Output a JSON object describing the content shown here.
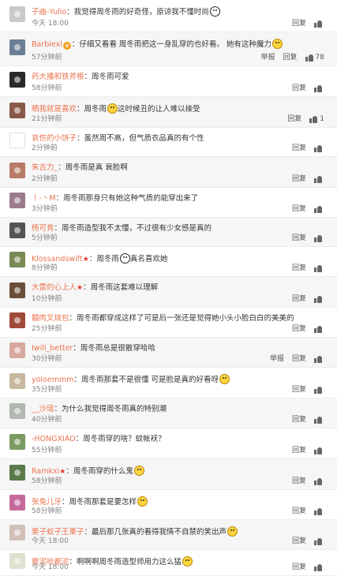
{
  "labels": {
    "reply": "回复",
    "report": "举报"
  },
  "colors": {
    "username": "#eb7350",
    "time": "#808080",
    "alt_row": "#f6f6f6"
  },
  "comments": [
    {
      "user": "子曲-Yulio",
      "badge": "",
      "text": "我觉得周冬雨的好奇怪，原谅我不懂时尚",
      "emoji": "face2",
      "time": "今天 18:00",
      "report": false,
      "likes": "",
      "avatar_color": "#c9c9c9"
    },
    {
      "user": "Barbiexl",
      "badge": "v",
      "text": "仔细又看看 周冬雨把这一身乱穿的也好看。 她有这种魔力",
      "emoji": "yellow",
      "time": "57分钟前",
      "report": true,
      "likes": "78",
      "avatar_color": "#6a7e96"
    },
    {
      "user": "药大播和铁斧根",
      "badge": "",
      "text": "周冬雨可爱",
      "emoji": "",
      "time": "58分钟前",
      "report": false,
      "likes": "",
      "avatar_color": "#2a2a2a"
    },
    {
      "user": "晒我就是喜欢",
      "badge": "",
      "text": "周冬雨",
      "emoji": "yellow",
      "text2": "这时候丑的让人难以接受",
      "time": "21分钟前",
      "report": false,
      "likes": "1",
      "avatar_color": "#8a5a48"
    },
    {
      "user": "哀伤的小饼子",
      "badge": "",
      "text": "虽然周不高，但气质衣品真的有个性",
      "emoji": "",
      "time": "2分钟前",
      "report": false,
      "likes": "",
      "avatar_color": "#ffffff"
    },
    {
      "user": "朱古力_",
      "badge": "",
      "text": "周冬雨是真 衰脸啊",
      "emoji": "",
      "time": "2分钟前",
      "report": false,
      "likes": "",
      "avatar_color": "#b77a66"
    },
    {
      "user": "丨-丶M",
      "badge": "",
      "text": "周冬雨那身只有她这种气质的能穿出来了",
      "emoji": "",
      "time": "3分钟前",
      "report": false,
      "likes": "",
      "avatar_color": "#9c7a8e"
    },
    {
      "user": "杨可肯",
      "badge": "",
      "text": "周冬雨造型我不太懂，不过很有少女感是真的",
      "emoji": "",
      "time": "5分钟前",
      "report": false,
      "likes": "",
      "avatar_color": "#555555"
    },
    {
      "user": "Klossandswift",
      "badge": "star",
      "text": "周冬雨",
      "emoji": "face2",
      "text2": "真名喜欢她",
      "time": "8分钟前",
      "report": false,
      "likes": "",
      "avatar_color": "#7a8a55"
    },
    {
      "user": "大雷的心上人",
      "badge": "star",
      "text": "周冬雨这套难以理解",
      "emoji": "",
      "time": "10分钟前",
      "report": false,
      "likes": "",
      "avatar_color": "#6b4e3a"
    },
    {
      "user": "髓肉叉烧包",
      "badge": "",
      "text": "周冬雨都穿成这样了可是后一张还是觉得她小头小脸白白的美美的",
      "emoji": "",
      "time": "25分钟前",
      "report": false,
      "likes": "",
      "avatar_color": "#a04a3a"
    },
    {
      "user": "Iwill_better",
      "badge": "",
      "text": "周冬雨总是很散穿哈哈",
      "emoji": "",
      "time": "30分钟前",
      "report": true,
      "likes": "",
      "avatar_color": "#d8a8a0"
    },
    {
      "user": "yoloemmm",
      "badge": "",
      "text": "周冬雨那套不是很懂 可是脸是真的好看呀",
      "emoji": "yellow",
      "time": "35分钟前",
      "report": false,
      "likes": "",
      "avatar_color": "#c8b8a0"
    },
    {
      "user": "__沙瑶",
      "badge": "",
      "text": "为什么我觉得周冬雨真的特别潮",
      "emoji": "",
      "time": "40分钟前",
      "report": false,
      "likes": "",
      "avatar_color": "#b0b8b0"
    },
    {
      "user": "-HONGXIAO",
      "badge": "",
      "text": "周冬雨穿的啥？蚊帐袄？",
      "emoji": "",
      "time": "55分钟前",
      "report": false,
      "likes": "",
      "avatar_color": "#7a9a60"
    },
    {
      "user": "Ramkxi",
      "badge": "star",
      "text": "周冬雨穿的什么鬼",
      "emoji": "yellow",
      "time": "58分钟前",
      "report": false,
      "likes": "",
      "avatar_color": "#5a7a4a"
    },
    {
      "user": "张兔儿牙",
      "badge": "",
      "text": "周冬雨那套是要怎样",
      "emoji": "yellow",
      "time": "58分钟前",
      "report": false,
      "likes": "",
      "avatar_color": "#c46a9a"
    },
    {
      "user": "栗子蚊子王栗子",
      "badge": "",
      "text": "最后那几张真的看得我情不自禁的笑出声",
      "emoji": "yellow",
      "time": "今天 18:00",
      "report": false,
      "likes": "",
      "avatar_color": "#d0c0b8"
    },
    {
      "user": "察泥哈都泥",
      "badge": "",
      "text": "啊啊啊周冬雨造型师用力这么猛",
      "emoji": "yellow",
      "time": "今天 18:00",
      "report": false,
      "likes": "",
      "avatar_color": "#e0e0d0"
    }
  ]
}
